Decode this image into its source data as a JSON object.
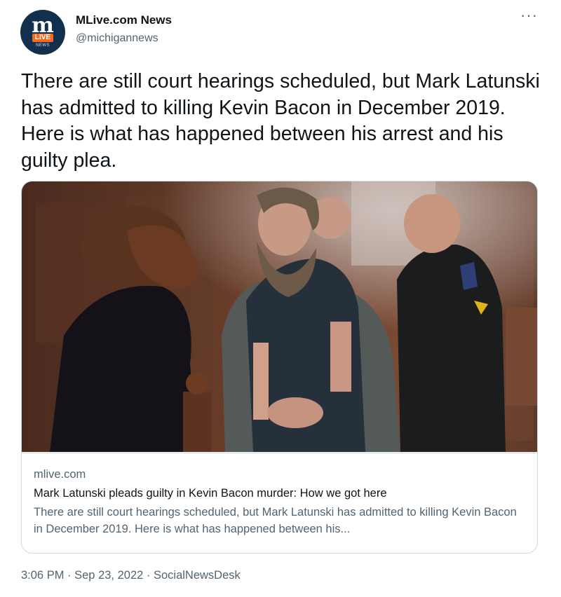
{
  "account": {
    "avatar_text_main": "m",
    "avatar_text_badge": "LIVE",
    "avatar_text_sub": "NEWS",
    "name": "MLive.com News",
    "handle": "@michigannews"
  },
  "more_glyph": "···",
  "tweet": {
    "text": "There are still court hearings scheduled, but Mark Latunski has admitted to killing Kevin Bacon in December 2019. Here is what has happened between his arrest and his guilty plea."
  },
  "card": {
    "domain": "mlive.com",
    "title": "Mark Latunski pleads guilty in Kevin Bacon murder: How we got here",
    "description": "There are still court hearings scheduled, but Mark Latunski has admitted to killing Kevin Bacon in December 2019. Here is what has happened between his..."
  },
  "footer": {
    "time": "3:06 PM",
    "separator": " · ",
    "date": "Sep 23, 2022",
    "source": "SocialNewsDesk"
  },
  "colors": {
    "text_primary": "#0f1419",
    "text_secondary": "#536471",
    "border": "#cfd9de",
    "avatar_bg": "#12304d",
    "avatar_accent": "#f26b21"
  }
}
